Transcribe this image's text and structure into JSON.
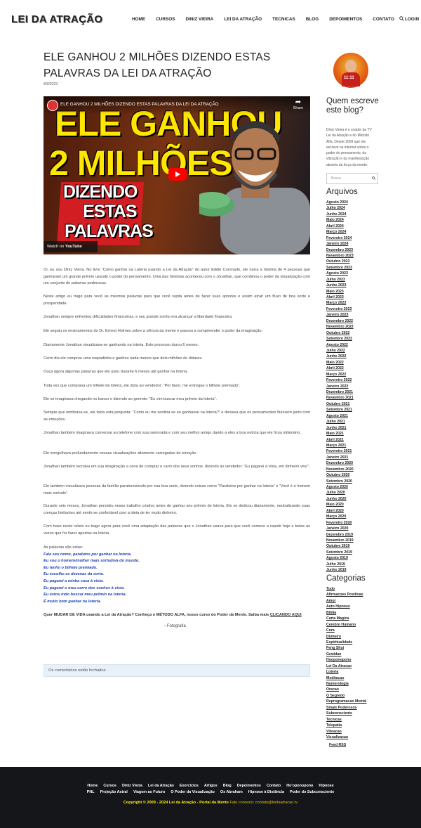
{
  "site": {
    "logo": "LEI DA ATRAÇÃO"
  },
  "nav": [
    "HOME",
    "CURSOS",
    "DINIZ VIEIRA",
    "LEI DA ATRAÇÃO",
    "TECNICAS",
    "BLOG",
    "DEPOIMENTOS",
    "CONTATO",
    "LOGIN"
  ],
  "article": {
    "title": "ELE GANHOU 2 MILHÕES DIZENDO ESTAS PALAVRAS DA LEI DA ATRAÇÃO",
    "date": "8/9/2023",
    "video": {
      "title": "ELE GANHOU 2 MILHÕES DIZENDO ESTAS PALAVRAS DA LEI DA ATRAÇÃO",
      "share_label": "Share",
      "watch_on": "Watch on",
      "youtube": "YouTube",
      "thumb_line1": "ELE GANHOU",
      "thumb_line2": "2 MILHÕES",
      "thumb_line3": "DIZENDO",
      "thumb_line4": "ESTAS",
      "thumb_line5": "PALAVRAS"
    },
    "paragraphs": [
      "Oi, eu sou Diniz Vieira. No livro “Como ganhar na Loteria usando a Lei da Atração” do autor Eddie Coronado, ele narra a história de 4 pessoas que ganharam um grande prêmio usando o poder do pensamento. Uma das histórias aconteceu com o Jonathan, que combinou o poder da visualização com um conjunto de palavras poderosas.",
      "Neste artigo eu trago para você as mesmas palavras para que você repita antes de fazer suas apostas e assim atrair um fluxo de boa sorte e prosperidade.",
      "Jonathan sempre enfrentou dificuldades financeiras, e seu grande sonho era alcançar a liberdade financeira.",
      "Ele seguiu os ensinamentos do Dr. Ernest Holmes sobre a ciência da mente e passou a compreender o poder da imaginação.",
      "Diariamente Jonathan visualizava-se ganhando na loteria. Este processo durou 6 meses.",
      "Certo dia ele comprou uma raspadinha e ganhou nada menos que dois milhões de dólares.",
      "Ouça agora algumas palavras que ele usou durante 6 meses até ganhar na loteria.",
      "Toda vez que comprava um bilhete de loteria, ele dizia ao vendedor: “Por favor, me entregue o bilhete premiado”.",
      "Ele se imaginava chegando no banco e dizendo ao gerente: “Eu vim buscar meu prêmio da loteria”.",
      "Sempre que lembrava-se, ele fazia esta pergunta: “Como eu me sentiria se eu ganhasse na loteria?” e deixava que os pensamentos fluíssem junto com as emoções.",
      "Jonathan também imaginava conversar ao telefone com sua namorada e com seu melhor amigo dando a eles a boa notícia que ele ficou milionário.",
      "Ele mergulhava profundamente nessas visualizações altamente carregadas de emoção.",
      "Jonathan também recriava em sua imaginação a cena de comprar o carro dos seus sonhos, dizendo ao vendedor: “Eu pagarei à vista, em dinheiro vivo”.",
      "Ele também visualizava pessoas da família parabenizando por sua boa sorte, dizendo coisas como “Parabéns por ganhar na loteria” e “Você é o homem mais sortudo”.",
      "Durante seis meses, Jonathan persistiu nesse trabalho criativo antes de ganhar seu prêmio de loteria. Ele se dedicou diariamente, neutralizando suas crenças limitantes até sentir-se confortável com a ideia de ter muito dinheiro.",
      "Com base neste relato eu trago agora para você uma adaptação das palavras que o Jonathan usava para que você comece a repetir hoje e todas as vezes que for fazer apostas na loteria."
    ],
    "phrases_intro": "As palavras são estas:",
    "phrases": [
      "Fale seu nome, parabéns por ganhar na loteria.",
      "Eu sou o homem/mulher mais sortudo/a do mundo.",
      "Eu tenho o bilhete premiado.",
      "Eu escolho as dezenas da sorte.",
      "Eu pagarei a minha casa à vista.",
      "Eu pagarei o meu carro dos sonhos à vista.",
      "Eu estou indo buscar meu prêmio na loteria.",
      "É muito bom ganhar na loteria."
    ],
    "cta_text": "Quer MUDAR DE VIDA usando a Lei da Atração? Conheça o MÉTODO ALFA, nosso curso do Poder da Mente. Saiba mais",
    "cta_link": "CLICANDO AQUI",
    "image_alt": "Fotografia",
    "comments_closed": "Os comentários estão fechados."
  },
  "sidebar": {
    "author_heading": "Quem escreve este blog?",
    "author_photo_text": "11:11",
    "author_text": "Diniz Vieira é o criador da TV Lei da Atração e do Método Alfa. Desde 2009 que ele escreve na internet sobre o poder do pensamento, da vibração e da manifestação através da força da mente.",
    "search_placeholder": "Busca",
    "archives_heading": "Arquivos",
    "archives": [
      "Agosto 2024",
      "Julho 2024",
      "Junho 2024",
      "Maio 2024",
      "Abril 2024",
      "Março 2024",
      "Fevereiro 2024",
      "Janeiro 2024",
      "Dezembro 2023",
      "Novembro 2023",
      "Outubro 2023",
      "Setembro 2023",
      "Agosto 2023",
      "Julho 2023",
      "Junho 2023",
      "Maio 2023",
      "Abril 2023",
      "Março 2023",
      "Fevereiro 2023",
      "Janeiro 2023",
      "Dezembro 2022",
      "Novembro 2022",
      "Outubro 2022",
      "Setembro 2022",
      "Agosto 2022",
      "Julho 2022",
      "Junho 2022",
      "Maio 2022",
      "Abril 2022",
      "Março 2022",
      "Fevereiro 2022",
      "Janeiro 2022",
      "Dezembro 2021",
      "Novembro 2021",
      "Outubro 2021",
      "Setembro 2021",
      "Agosto 2021",
      "Julho 2021",
      "Junho 2021",
      "Maio 2021",
      "Abril 2021",
      "Março 2021",
      "Fevereiro 2021",
      "Janeiro 2021",
      "Dezembro 2020",
      "Novembro 2020",
      "Outubro 2020",
      "Setembro 2020",
      "Agosto 2020",
      "Julho 2020",
      "Junho 2020",
      "Maio 2020",
      "Abril 2020",
      "Março 2020",
      "Fevereiro 2020",
      "Janeiro 2020",
      "Dezembro 2019",
      "Novembro 2019",
      "Outubro 2019",
      "Setembro 2019",
      "Agosto 2019",
      "Julho 2019",
      "Junho 2019"
    ],
    "categories_heading": "Categorias",
    "categories": [
      "Tudo",
      "Afirmacoes Positivas",
      "Amor",
      "Auto Hipnose",
      "Bíblia",
      "Carta Magica",
      "Cerebro Humano",
      "Cura",
      "Dinheiro",
      "Espiritualidade",
      "Feng Shui",
      "Gratidao",
      "Hooponopono",
      "Lei Da Atracao",
      "Loteria",
      "Meditacao",
      "Numerologia",
      "Oracao",
      "O Segredo",
      "Reprogramacao Mental",
      "Sinais Poderosos",
      "Subconsciente",
      "Tecnicas",
      "Telepatia",
      "Vibracao",
      "Visualizacao"
    ],
    "feed": "Feed RSS"
  },
  "footer": {
    "row1": [
      "Home",
      "Cursos",
      "Diniz Vieira",
      "Lei da Atração",
      "Exercícios",
      "Artigos",
      "Blog",
      "Depoimentos",
      "Contato",
      "Ho'oponopono",
      "Hipnose"
    ],
    "row2": [
      "PNL",
      "Projeção Astral",
      "Viagem ao Futuro",
      "O Poder da Visualização",
      "Os Abraham",
      "Hipnose à Distância",
      "Poder do Subconsciente"
    ],
    "copyright": "Copyright © 2009 - 2024 Lei da Atração - Portal da Mente",
    "contact": "Fale conosco: contato@leidaatracao.tv"
  }
}
